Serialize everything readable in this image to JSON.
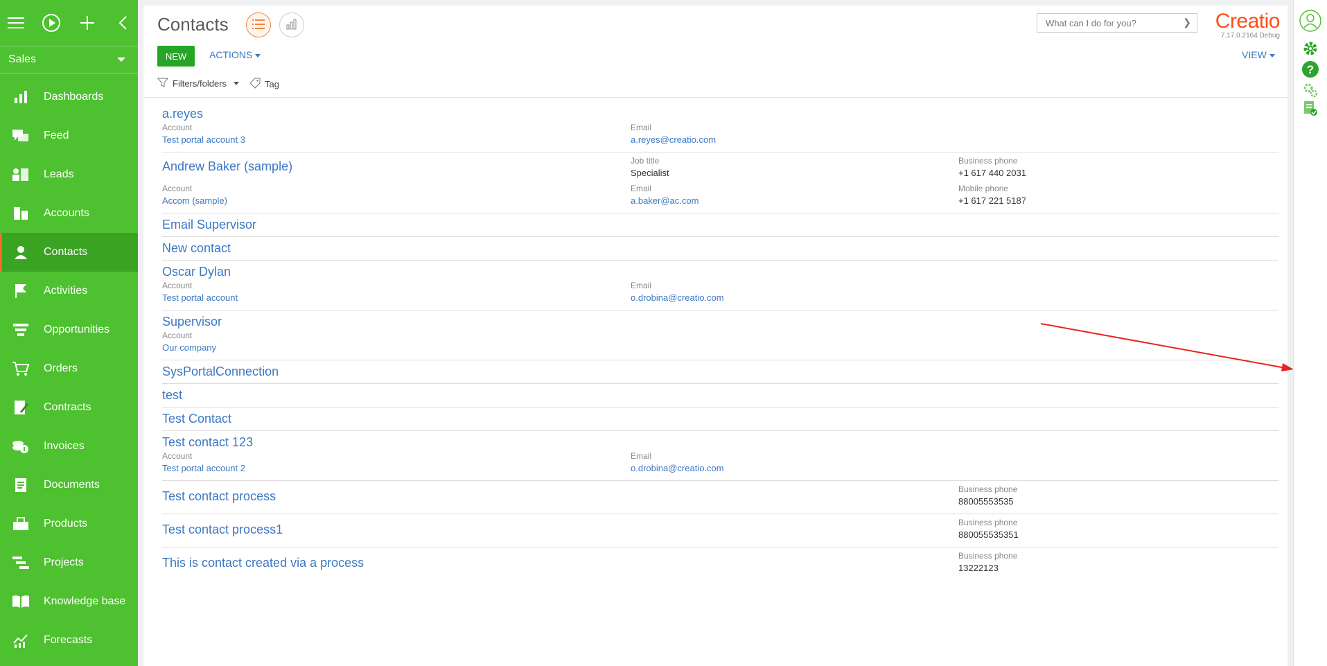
{
  "app": {
    "workspace": "Sales",
    "brand": "Creatio",
    "version": "7.17.0.2164 Debug"
  },
  "sidebar": {
    "items": [
      {
        "label": "Dashboards",
        "icon": "dashboards-icon"
      },
      {
        "label": "Feed",
        "icon": "feed-icon"
      },
      {
        "label": "Leads",
        "icon": "leads-icon"
      },
      {
        "label": "Accounts",
        "icon": "accounts-icon"
      },
      {
        "label": "Contacts",
        "icon": "contacts-icon",
        "active": true
      },
      {
        "label": "Activities",
        "icon": "flag-icon"
      },
      {
        "label": "Opportunities",
        "icon": "funnel-icon"
      },
      {
        "label": "Orders",
        "icon": "cart-icon"
      },
      {
        "label": "Contracts",
        "icon": "contract-icon"
      },
      {
        "label": "Invoices",
        "icon": "invoice-icon"
      },
      {
        "label": "Documents",
        "icon": "document-icon"
      },
      {
        "label": "Products",
        "icon": "products-icon"
      },
      {
        "label": "Projects",
        "icon": "projects-icon"
      },
      {
        "label": "Knowledge base",
        "icon": "book-icon"
      },
      {
        "label": "Forecasts",
        "icon": "forecast-icon"
      }
    ]
  },
  "header": {
    "title": "Contacts",
    "search_placeholder": "What can I do for you?",
    "new_label": "NEW",
    "actions_label": "ACTIONS",
    "view_label": "VIEW",
    "filters_label": "Filters/folders",
    "tag_label": "Tag"
  },
  "contacts": [
    {
      "name": "a.reyes",
      "account_label": "Account",
      "account": "Test portal account 3",
      "email_label": "Email",
      "email": "a.reyes@creatio.com"
    },
    {
      "name": "Andrew Baker (sample)",
      "job_label": "Job title",
      "job": "Specialist",
      "bphone_label": "Business phone",
      "bphone": "+1 617 440 2031",
      "account_label": "Account",
      "account": "Accom (sample)",
      "email_label": "Email",
      "email": "a.baker@ac.com",
      "mphone_label": "Mobile phone",
      "mphone": "+1 617 221 5187"
    },
    {
      "name": "Email Supervisor"
    },
    {
      "name": "New contact"
    },
    {
      "name": "Oscar Dylan",
      "account_label": "Account",
      "account": "Test portal account",
      "email_label": "Email",
      "email": "o.drobina@creatio.com"
    },
    {
      "name": "Supervisor",
      "account_label": "Account",
      "account": "Our company"
    },
    {
      "name": "SysPortalConnection"
    },
    {
      "name": "test"
    },
    {
      "name": "Test Contact"
    },
    {
      "name": "Test contact 123",
      "account_label": "Account",
      "account": "Test portal account 2",
      "email_label": "Email",
      "email": "o.drobina@creatio.com"
    },
    {
      "name": "Test contact process",
      "bphone_label": "Business phone",
      "bphone": "88005553535"
    },
    {
      "name": "Test contact process1",
      "bphone_label": "Business phone",
      "bphone": "880055535351"
    },
    {
      "name": "This is contact created via a process",
      "bphone_label": "Business phone",
      "bphone": "13222123"
    }
  ],
  "colors": {
    "sidebar": "#4dc12f",
    "accent": "#ff4d1a",
    "link": "#3c78c4",
    "new_button": "#27a527"
  }
}
